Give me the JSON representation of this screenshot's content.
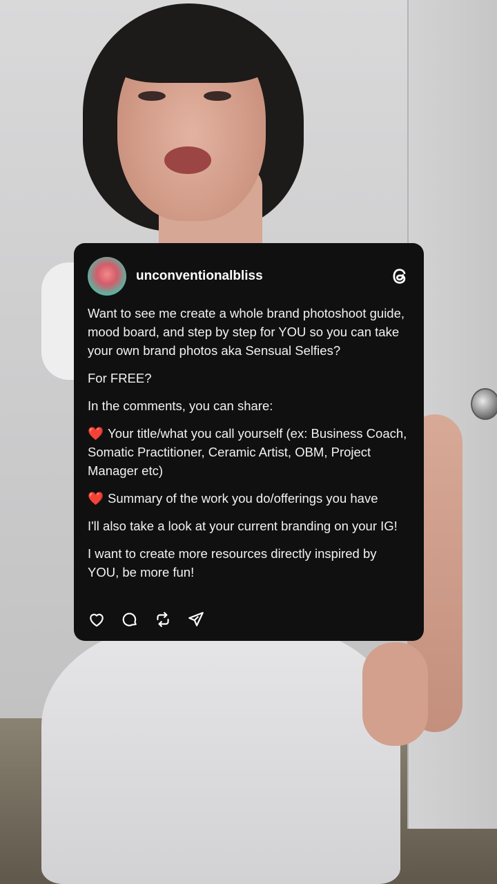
{
  "post": {
    "username": "unconventionalbliss",
    "paragraphs": {
      "p1": "Want to see me create a whole brand photoshoot guide, mood board, and step by step for YOU so you can take your own brand photos aka Sensual Selfies?",
      "p2": "For FREE?",
      "p3": "In the comments, you can share:",
      "p4": "Your title/what you call yourself (ex: Business Coach, Somatic Practitioner, Ceramic Artist, OBM, Project Manager etc)",
      "p5": "Summary of the work you do/offerings you have",
      "p6": "I'll also take a look at your current branding on your IG!",
      "p7": "I want to create more resources directly inspired by YOU, be more fun!"
    },
    "bullet_emoji": "❤️"
  },
  "colors": {
    "card_bg": "#101010",
    "text": "#f2f2f2"
  },
  "icons": [
    "threads-logo-icon",
    "heart-icon",
    "comment-icon",
    "repost-icon",
    "share-icon"
  ]
}
